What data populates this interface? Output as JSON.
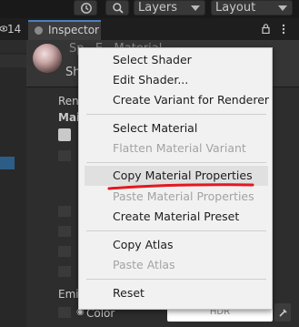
{
  "toolbar": {
    "history_icon": "history-icon",
    "search_icon": "search-icon",
    "layers_label": "Layers",
    "layout_label": "Layout"
  },
  "hierarchy": {
    "count": "14"
  },
  "inspector": {
    "tab_label": "Inspector",
    "material_name": "Sp...E...Material",
    "shader_prefix": "Sh",
    "rendering_label": "Ren",
    "main_label": "Mai",
    "emission_label": "Emi",
    "color_label": "Color",
    "hdr_label": "HDR"
  },
  "menu": {
    "items": [
      {
        "label": "Select Shader",
        "enabled": true
      },
      {
        "label": "Edit Shader...",
        "enabled": true
      },
      {
        "label": "Create Variant for Renderer",
        "enabled": true
      },
      {
        "label": "Select Material",
        "enabled": true
      },
      {
        "label": "Flatten Material Variant",
        "enabled": false
      },
      {
        "label": "Copy Material Properties",
        "enabled": true
      },
      {
        "label": "Paste Material Properties",
        "enabled": false
      },
      {
        "label": "Create Material Preset",
        "enabled": true
      },
      {
        "label": "Copy Atlas",
        "enabled": true
      },
      {
        "label": "Paste Atlas",
        "enabled": false
      },
      {
        "label": "Reset",
        "enabled": true
      }
    ]
  },
  "colors": {
    "accent": "#4a7fc1",
    "selection": "#2c5d87",
    "annotation_underline": "#e3191f"
  }
}
